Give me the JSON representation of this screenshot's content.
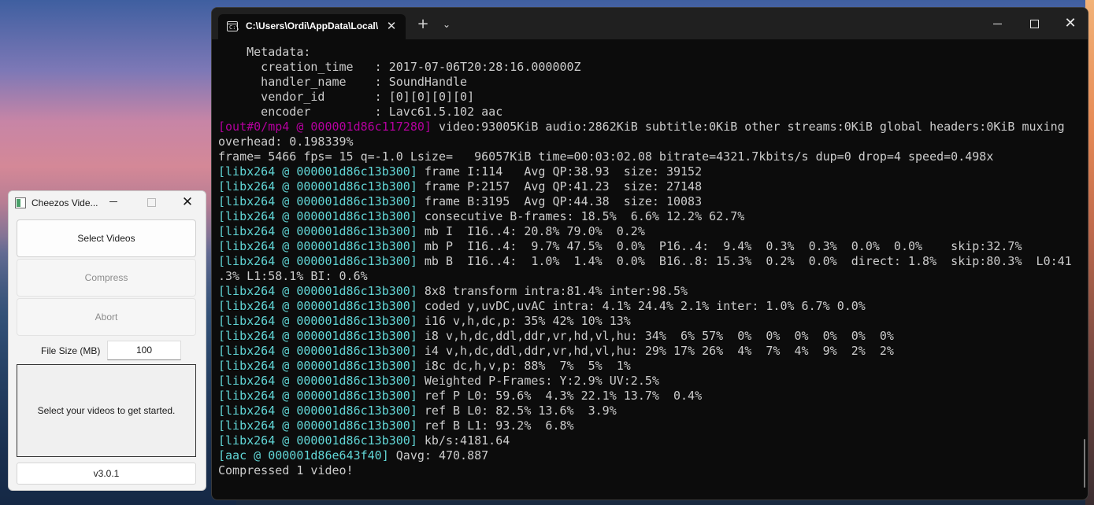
{
  "terminal": {
    "tab_title": "C:\\Users\\Ordi\\AppData\\Local\\",
    "tab_icon_glyph": "C:\\",
    "close_glyph": "✕",
    "newtab_glyph": "+",
    "dropdown_glyph": "⌄",
    "lines": [
      {
        "text": "    Metadata:"
      },
      {
        "text": "      creation_time   : 2017-07-06T20:28:16.000000Z"
      },
      {
        "text": "      handler_name    : SoundHandle"
      },
      {
        "text": "      vendor_id       : [0][0][0][0]"
      },
      {
        "text": "      encoder         : Lavc61.5.102 aac"
      },
      {
        "tag": "[out#0/mp4 @ 000001d86c117280]",
        "tag_class": "tag-out",
        "text": " video:93005KiB audio:2862KiB subtitle:0KiB other streams:0KiB global headers:0KiB muxing"
      },
      {
        "text": "overhead: 0.198339%"
      },
      {
        "text": "frame= 5466 fps= 15 q=-1.0 Lsize=   96057KiB time=00:03:02.08 bitrate=4321.7kbits/s dup=0 drop=4 speed=0.498x"
      },
      {
        "tag": "[libx264 @ 000001d86c13b300]",
        "tag_class": "tag-libx",
        "text": " frame I:114   Avg QP:38.93  size: 39152"
      },
      {
        "tag": "[libx264 @ 000001d86c13b300]",
        "tag_class": "tag-libx",
        "text": " frame P:2157  Avg QP:41.23  size: 27148"
      },
      {
        "tag": "[libx264 @ 000001d86c13b300]",
        "tag_class": "tag-libx",
        "text": " frame B:3195  Avg QP:44.38  size: 10083"
      },
      {
        "tag": "[libx264 @ 000001d86c13b300]",
        "tag_class": "tag-libx",
        "text": " consecutive B-frames: 18.5%  6.6% 12.2% 62.7%"
      },
      {
        "tag": "[libx264 @ 000001d86c13b300]",
        "tag_class": "tag-libx",
        "text": " mb I  I16..4: 20.8% 79.0%  0.2%"
      },
      {
        "tag": "[libx264 @ 000001d86c13b300]",
        "tag_class": "tag-libx",
        "text": " mb P  I16..4:  9.7% 47.5%  0.0%  P16..4:  9.4%  0.3%  0.3%  0.0%  0.0%    skip:32.7%"
      },
      {
        "tag": "[libx264 @ 000001d86c13b300]",
        "tag_class": "tag-libx",
        "text": " mb B  I16..4:  1.0%  1.4%  0.0%  B16..8: 15.3%  0.2%  0.0%  direct: 1.8%  skip:80.3%  L0:41"
      },
      {
        "text": ".3% L1:58.1% BI: 0.6%"
      },
      {
        "tag": "[libx264 @ 000001d86c13b300]",
        "tag_class": "tag-libx",
        "text": " 8x8 transform intra:81.4% inter:98.5%"
      },
      {
        "tag": "[libx264 @ 000001d86c13b300]",
        "tag_class": "tag-libx",
        "text": " coded y,uvDC,uvAC intra: 4.1% 24.4% 2.1% inter: 1.0% 6.7% 0.0%"
      },
      {
        "tag": "[libx264 @ 000001d86c13b300]",
        "tag_class": "tag-libx",
        "text": " i16 v,h,dc,p: 35% 42% 10% 13%"
      },
      {
        "tag": "[libx264 @ 000001d86c13b300]",
        "tag_class": "tag-libx",
        "text": " i8 v,h,dc,ddl,ddr,vr,hd,vl,hu: 34%  6% 57%  0%  0%  0%  0%  0%  0%"
      },
      {
        "tag": "[libx264 @ 000001d86c13b300]",
        "tag_class": "tag-libx",
        "text": " i4 v,h,dc,ddl,ddr,vr,hd,vl,hu: 29% 17% 26%  4%  7%  4%  9%  2%  2%"
      },
      {
        "tag": "[libx264 @ 000001d86c13b300]",
        "tag_class": "tag-libx",
        "text": " i8c dc,h,v,p: 88%  7%  5%  1%"
      },
      {
        "tag": "[libx264 @ 000001d86c13b300]",
        "tag_class": "tag-libx",
        "text": " Weighted P-Frames: Y:2.9% UV:2.5%"
      },
      {
        "tag": "[libx264 @ 000001d86c13b300]",
        "tag_class": "tag-libx",
        "text": " ref P L0: 59.6%  4.3% 22.1% 13.7%  0.4%"
      },
      {
        "tag": "[libx264 @ 000001d86c13b300]",
        "tag_class": "tag-libx",
        "text": " ref B L0: 82.5% 13.6%  3.9%"
      },
      {
        "tag": "[libx264 @ 000001d86c13b300]",
        "tag_class": "tag-libx",
        "text": " ref B L1: 93.2%  6.8%"
      },
      {
        "tag": "[libx264 @ 000001d86c13b300]",
        "tag_class": "tag-libx",
        "text": " kb/s:4181.64"
      },
      {
        "tag": "[aac @ 000001d86e643f40]",
        "tag_class": "tag-aac",
        "text": " Qavg: 470.887"
      },
      {
        "text": "Compressed 1 video!"
      }
    ]
  },
  "app": {
    "title": "Cheezos Vide...",
    "close_glyph": "✕",
    "buttons": {
      "select": "Select Videos",
      "compress": "Compress",
      "abort": "Abort"
    },
    "file_size_label": "File Size (MB)",
    "file_size_value": "100",
    "status": "Select your videos to get started.",
    "version": "v3.0.1"
  },
  "colors": {
    "terminal_bg": "#0c0c0c",
    "cyan_tag": "#61d6d6",
    "magenta_tag": "#b4009e",
    "terminal_text": "#cccccc"
  }
}
